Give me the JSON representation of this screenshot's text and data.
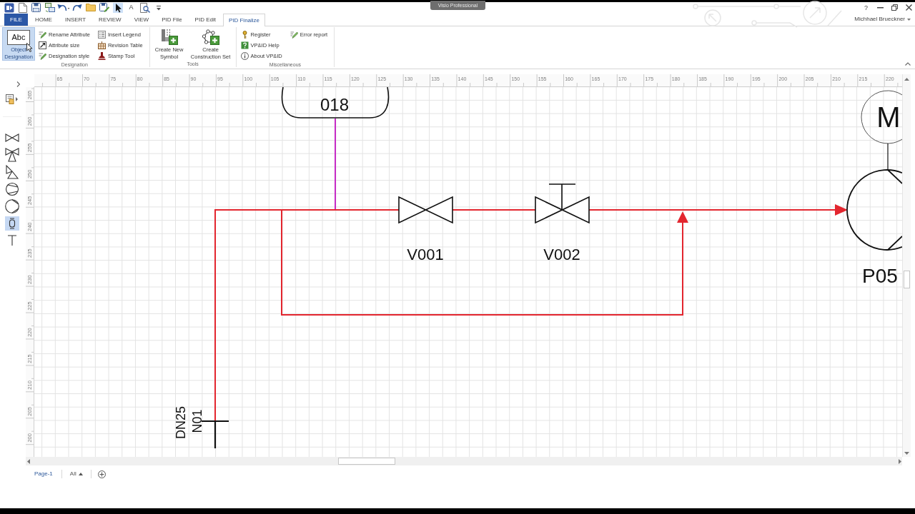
{
  "window": {
    "title": "Visio Professional",
    "help": "?",
    "user": "Michhael Brueckner"
  },
  "quick_access": [
    {
      "kind": "app",
      "selected": false
    },
    {
      "kind": "new",
      "selected": false
    },
    {
      "kind": "save",
      "selected": false
    },
    {
      "kind": "computers",
      "selected": false
    },
    {
      "kind": "undo",
      "selected": false
    },
    {
      "kind": "redo",
      "selected": false
    },
    {
      "kind": "open",
      "selected": false
    },
    {
      "kind": "save_as",
      "selected": false
    },
    {
      "kind": "pointer",
      "selected": true
    },
    {
      "kind": "text",
      "glyph": "A",
      "selected": false
    },
    {
      "kind": "preview",
      "selected": false
    },
    {
      "kind": "customize",
      "selected": false
    }
  ],
  "tabs": [
    {
      "label": "FILE",
      "kind": "backstage",
      "selected": false
    },
    {
      "label": "HOME",
      "kind": "tab",
      "selected": false
    },
    {
      "label": "INSERT",
      "kind": "tab",
      "selected": false
    },
    {
      "label": "REVIEW",
      "kind": "tab",
      "selected": false
    },
    {
      "label": "VIEW",
      "kind": "tab",
      "selected": false
    },
    {
      "label": "PID File",
      "kind": "tab",
      "selected": false
    },
    {
      "label": "PID Edit",
      "kind": "tab",
      "selected": false
    },
    {
      "label": "PID Finalize",
      "kind": "tab",
      "selected": true
    }
  ],
  "ribbon": {
    "groups": [
      {
        "label": "Designation",
        "items": [
          {
            "kind": "large",
            "label": "Object Designation",
            "icon_text": "Abc",
            "highlighted": true
          },
          {
            "kind": "small",
            "label": "Rename Attribute",
            "highlighted": false
          },
          {
            "kind": "small",
            "label": "Attribute size",
            "highlighted": false
          },
          {
            "kind": "small",
            "label": "Designation style",
            "highlighted": false
          },
          {
            "kind": "small",
            "label": "Insert Legend",
            "highlighted": false
          },
          {
            "kind": "small",
            "label": "Revision Table",
            "highlighted": false
          },
          {
            "kind": "small",
            "label": "Stamp Tool",
            "highlighted": false
          }
        ]
      },
      {
        "label": "Tools",
        "items": [
          {
            "kind": "large",
            "label": "Create New Symbol",
            "highlighted": false
          },
          {
            "kind": "large",
            "label": "Create Construction Set",
            "highlighted": false
          }
        ]
      },
      {
        "label": "Miscellaneous",
        "items": [
          {
            "kind": "small",
            "label": "Register",
            "highlighted": false
          },
          {
            "kind": "small",
            "label": "VP&ID Help",
            "highlighted": false
          },
          {
            "kind": "small",
            "label": "About VP&ID",
            "highlighted": false
          },
          {
            "kind": "small",
            "label": "Error report",
            "highlighted": false
          }
        ]
      }
    ]
  },
  "shapes_panel": {
    "shapes": [
      {
        "selected": false
      },
      {
        "selected": false
      },
      {
        "selected": false
      },
      {
        "selected": false
      },
      {
        "selected": false
      },
      {
        "selected": true
      },
      {
        "selected": false
      }
    ]
  },
  "rulers": {
    "horizontal": [
      "65",
      "70",
      "75",
      "80",
      "85",
      "90",
      "95",
      "100",
      "105",
      "110",
      "115",
      "120",
      "125",
      "130",
      "135",
      "140",
      "145",
      "150",
      "155",
      "160",
      "165",
      "170",
      "175",
      "180",
      "185",
      "190",
      "195",
      "200",
      "205",
      "210",
      "215",
      "220"
    ],
    "vertical": [
      "265",
      "260",
      "255",
      "250",
      "245",
      "240",
      "235",
      "230",
      "225",
      "220",
      "215",
      "210",
      "205",
      "200"
    ]
  },
  "diagram": {
    "vessel": {
      "label": "018"
    },
    "valves": [
      {
        "label": "V001",
        "kind": "manual"
      },
      {
        "label": "V002",
        "kind": "actuated"
      }
    ],
    "pump": {
      "label": "P05",
      "motor_label": "M"
    },
    "nozzle": {
      "label": "N01",
      "size": "DN25"
    }
  },
  "pages": {
    "tabs": [
      {
        "label": "Page-1",
        "selected": true
      }
    ],
    "all_label": "All"
  }
}
